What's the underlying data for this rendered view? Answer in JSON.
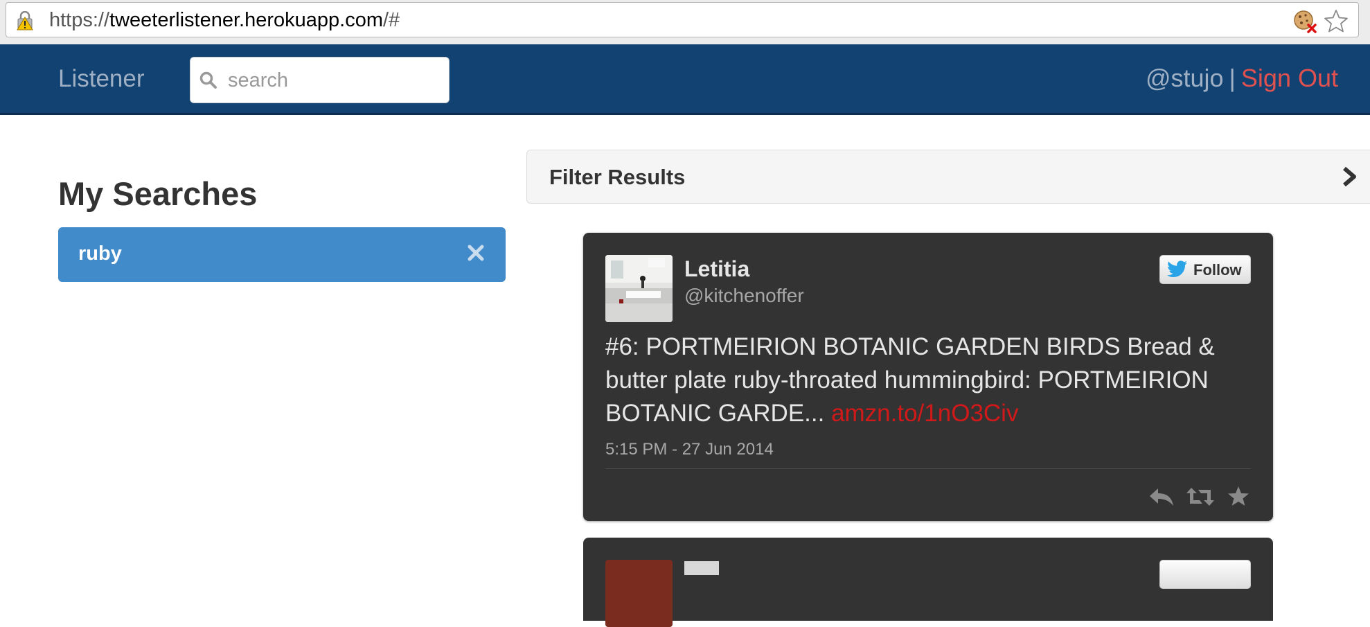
{
  "browser": {
    "url_prefix": "https://",
    "url_host": "tweeterlistener.herokuapp.com",
    "url_suffix": "/#"
  },
  "navbar": {
    "brand": "Listener",
    "search_placeholder": "search",
    "user_handle": "@stujo",
    "separator": "|",
    "sign_out": "Sign Out"
  },
  "sidebar": {
    "title": "My Searches",
    "searches": [
      {
        "label": "ruby"
      }
    ]
  },
  "filter": {
    "title": "Filter Results"
  },
  "tweets": [
    {
      "name": "Letitia",
      "handle": "@kitchenoffer",
      "follow_label": "Follow",
      "text": "#6: PORTMEIRION BOTANIC GARDEN BIRDS Bread & butter plate ruby-throated hummingbird: PORTMEIRION BOTANIC GARDE... ",
      "link": "amzn.to/1nO3Civ",
      "timestamp": "5:15 PM - 27 Jun 2014"
    }
  ],
  "colors": {
    "navbar_bg": "#124272",
    "accent_blue": "#428bca",
    "sign_out_red": "#e0514f",
    "card_bg": "#333333",
    "link_red": "#d11919"
  },
  "icons": {
    "lock": "lock-warning-icon",
    "cookie": "cookie-blocked-icon",
    "bookmark": "star-icon",
    "search": "search-icon",
    "remove": "close-icon",
    "chevron": "chevron-right-icon",
    "twitter": "twitter-bird-icon",
    "reply": "reply-icon",
    "retweet": "retweet-icon",
    "favorite": "star-icon"
  }
}
